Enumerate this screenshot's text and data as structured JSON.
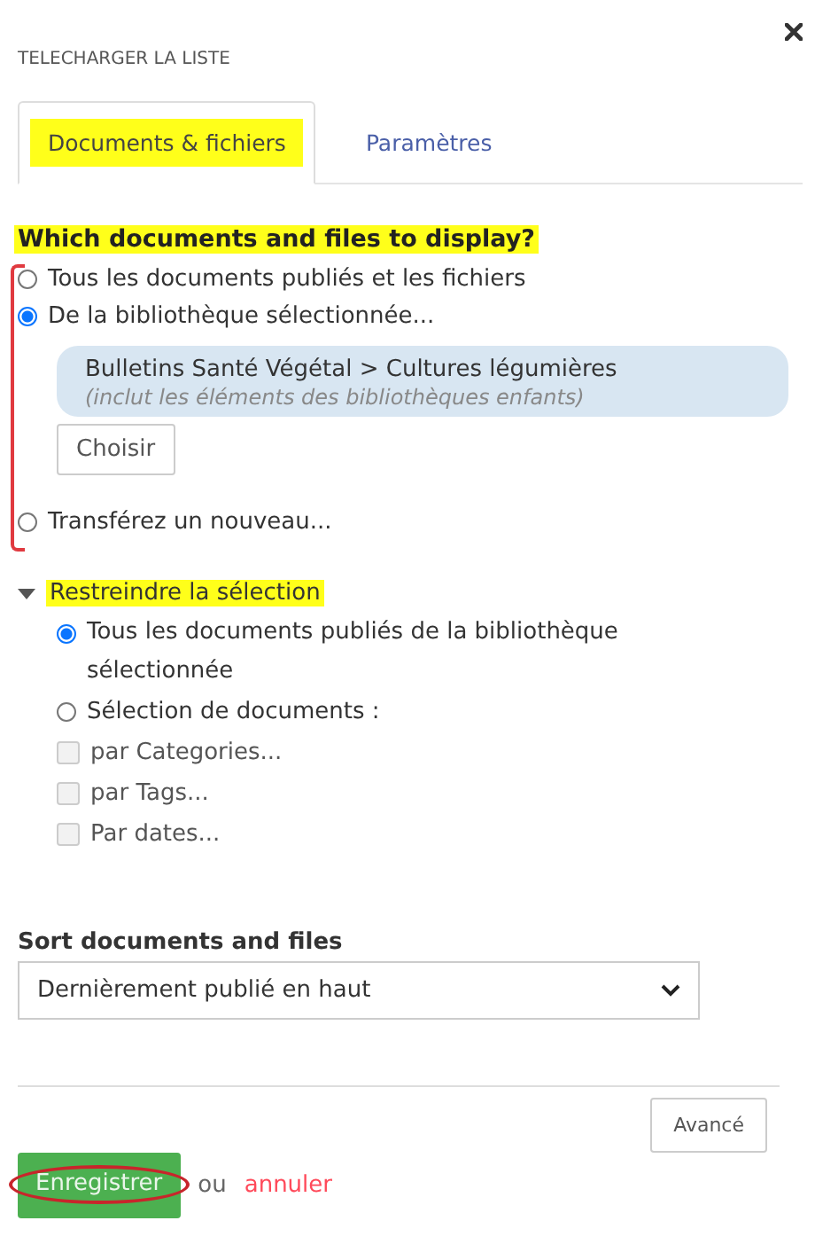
{
  "dialog": {
    "title": "TELECHARGER LA LISTE"
  },
  "tabs": [
    {
      "label": "Documents & fichiers",
      "selected": true,
      "highlighted": true
    },
    {
      "label": "Paramètres",
      "selected": false,
      "highlighted": false
    }
  ],
  "source": {
    "heading": "Which documents and files to display?",
    "highlighted": true,
    "bracketed": true,
    "options": [
      {
        "label": "Tous les documents publiés et les fichiers",
        "selected": false
      },
      {
        "label": "De la bibliothèque sélectionnée...",
        "selected": true,
        "library": {
          "path": "Bulletins Santé Végétal > Cultures légumières",
          "note": "(inclut les éléments des bibliothèques enfants)",
          "button": "Choisir"
        }
      },
      {
        "label": "Transférez un nouveau...",
        "selected": false
      }
    ]
  },
  "restrict": {
    "heading": "Restreindre la sélection",
    "highlighted": true,
    "expanded": true,
    "items": [
      {
        "kind": "radio",
        "label": "Tous les documents publiés de la bibliothèque sélectionnée",
        "selected": true
      },
      {
        "kind": "radio",
        "label": "Sélection de documents :",
        "selected": false
      },
      {
        "kind": "checkbox",
        "label": "par Categories...",
        "checked": false,
        "disabled": true
      },
      {
        "kind": "checkbox",
        "label": "par Tags...",
        "checked": false,
        "disabled": true
      },
      {
        "kind": "checkbox",
        "label": "Par dates...",
        "checked": false,
        "disabled": true
      }
    ]
  },
  "sort": {
    "label": "Sort documents and files",
    "value": "Dernièrement publié en haut"
  },
  "footer": {
    "advanced_button": "Avancé",
    "save_button": "Enregistrer",
    "save_circled": true,
    "separator": "ou",
    "cancel_link": "annuler"
  }
}
